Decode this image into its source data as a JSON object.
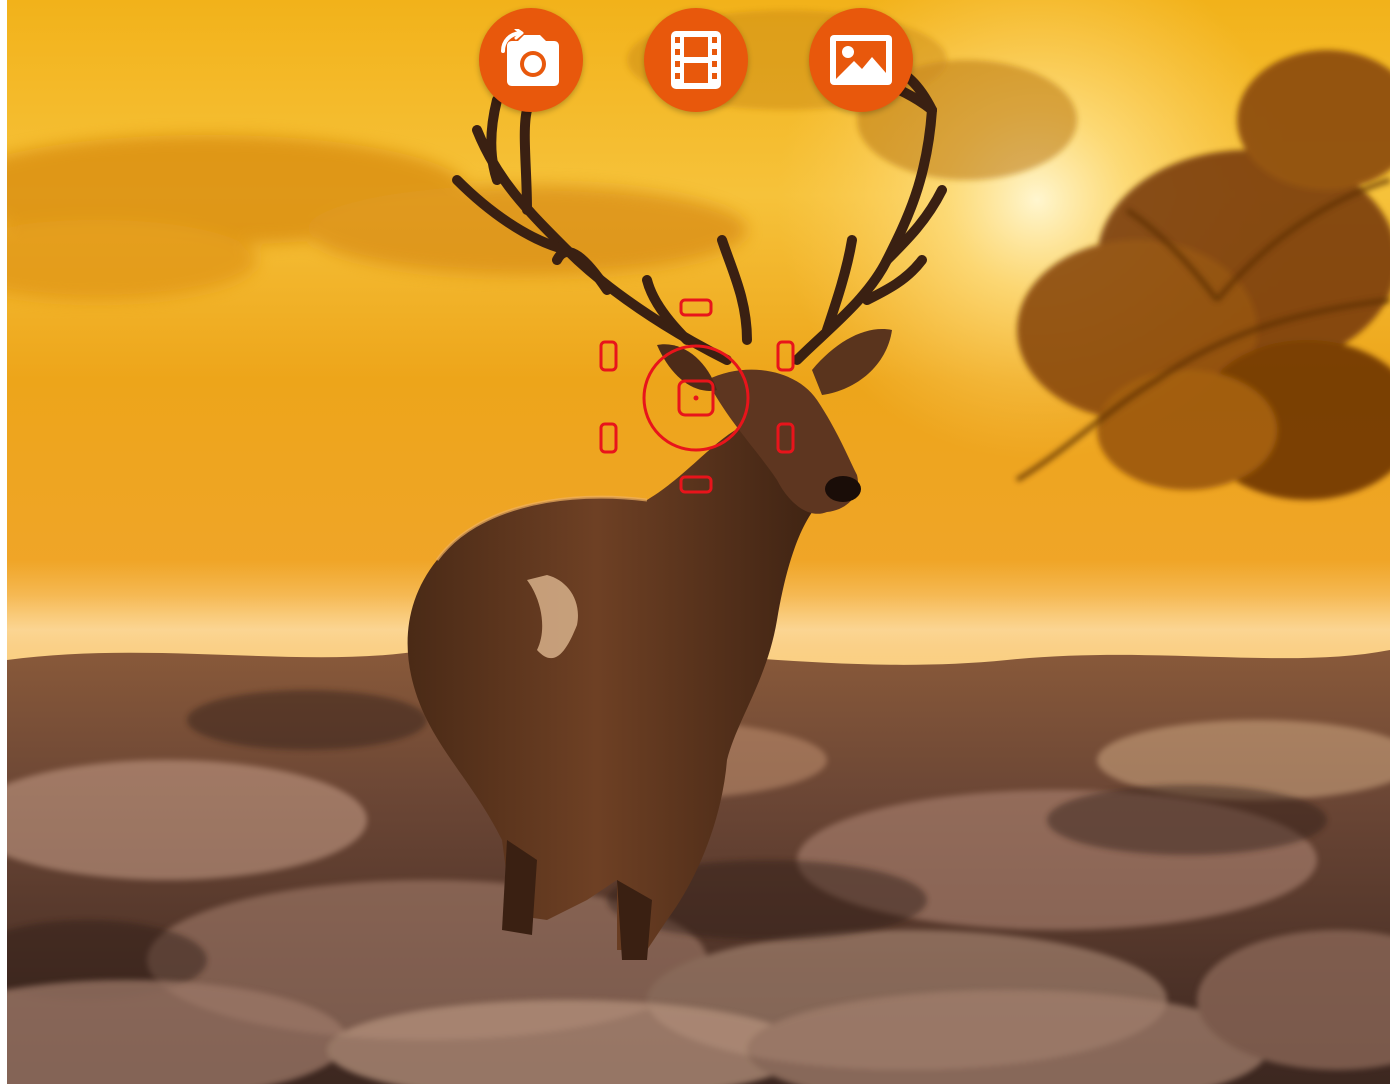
{
  "app": {
    "screen": "camera-viewfinder"
  },
  "theme": {
    "accent": "#E8580C",
    "icon_color": "#FFFFFF",
    "focus_color": "#E8141B"
  },
  "mode_buttons": [
    {
      "id": "photo",
      "icon": "camera-switch-icon"
    },
    {
      "id": "video",
      "icon": "film-strip-icon"
    },
    {
      "id": "gallery",
      "icon": "image-gallery-icon"
    }
  ],
  "focus": {
    "reticle_icon": "focus-reticle-icon",
    "marker_count": 6
  }
}
